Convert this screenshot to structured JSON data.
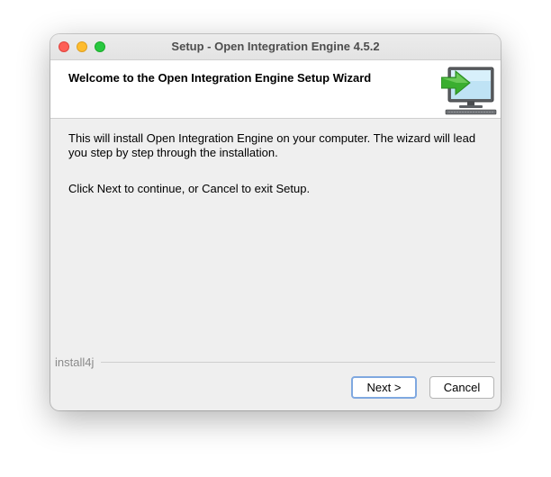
{
  "window": {
    "title": "Setup - Open Integration Engine 4.5.2"
  },
  "header": {
    "title": "Welcome to the Open Integration Engine Setup Wizard",
    "icon": "computer-with-green-arrow-icon"
  },
  "content": {
    "paragraph1": "This will install Open Integration Engine on your computer. The wizard will lead you step by step through the installation.",
    "paragraph2": "Click Next to continue, or Cancel to exit Setup."
  },
  "footer": {
    "brand": "install4j",
    "next_label": "Next >",
    "cancel_label": "Cancel"
  },
  "colors": {
    "close": "#fe5f57",
    "minimize": "#febc2e",
    "zoom": "#28c840",
    "focus_ring": "#7fa8e0"
  }
}
